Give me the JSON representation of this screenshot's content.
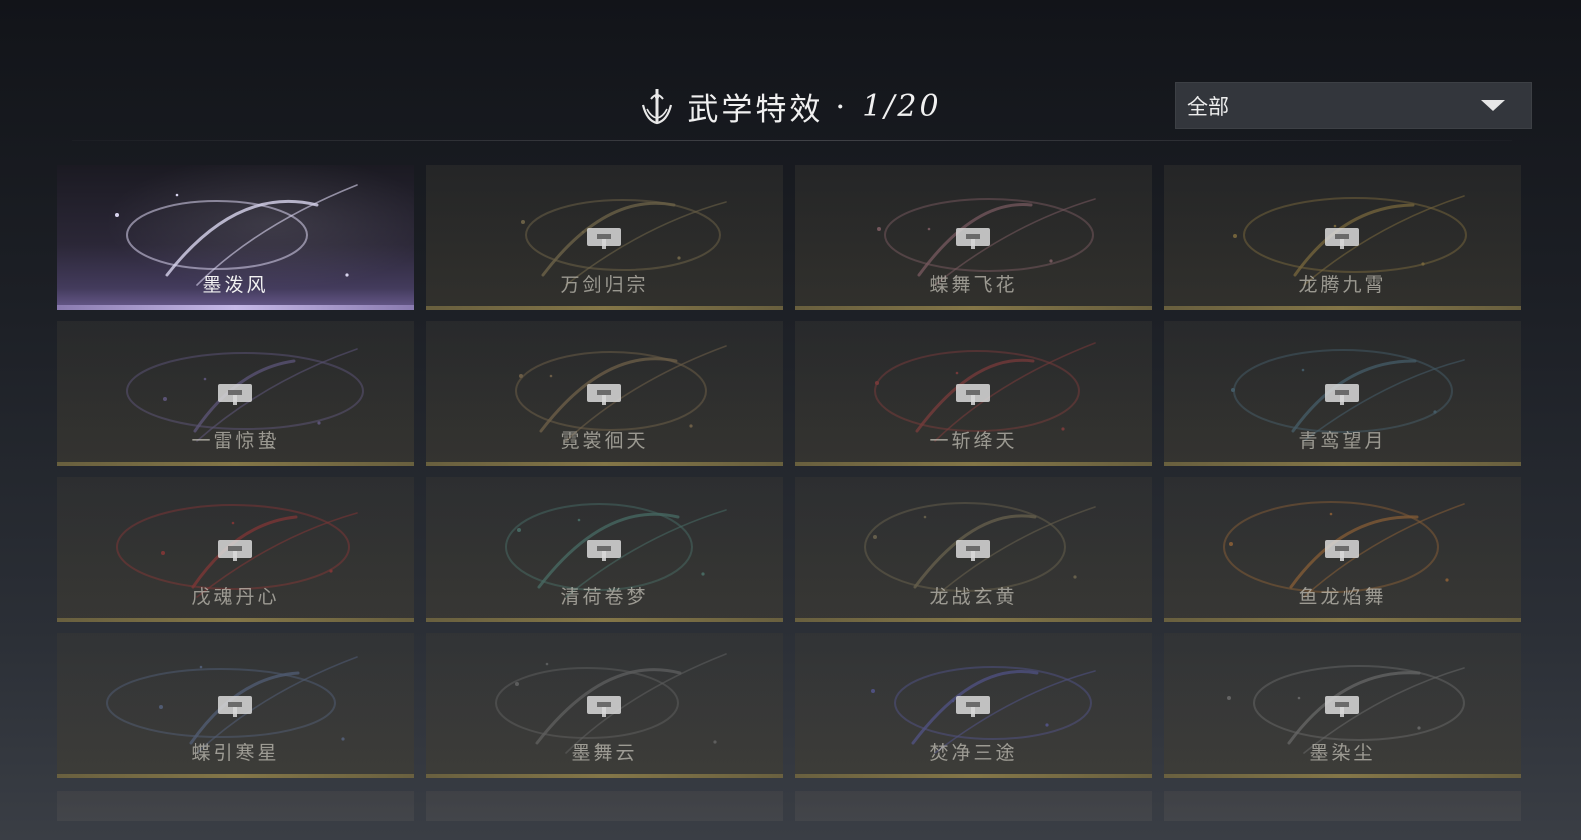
{
  "header": {
    "title": "武学特效",
    "separator": "·",
    "count": "1/20"
  },
  "filter": {
    "selected": "全部"
  },
  "effects": [
    {
      "name": "墨泼风",
      "unlocked": true,
      "theme": "#d8d4ee"
    },
    {
      "name": "万剑归宗",
      "unlocked": false,
      "theme": "#b9a36a"
    },
    {
      "name": "蝶舞飞花",
      "unlocked": false,
      "theme": "#c98a98"
    },
    {
      "name": "龙腾九霄",
      "unlocked": false,
      "theme": "#c9a650"
    },
    {
      "name": "一雷惊蛰",
      "unlocked": false,
      "theme": "#8f7ec9"
    },
    {
      "name": "霓裳徊天",
      "unlocked": false,
      "theme": "#b49565"
    },
    {
      "name": "一斩绛天",
      "unlocked": false,
      "theme": "#c94848"
    },
    {
      "name": "青鸾望月",
      "unlocked": false,
      "theme": "#5e8ea8"
    },
    {
      "name": "戊魂丹心",
      "unlocked": false,
      "theme": "#d43a3a"
    },
    {
      "name": "清荷卷梦",
      "unlocked": false,
      "theme": "#5fa79a"
    },
    {
      "name": "龙战玄黄",
      "unlocked": false,
      "theme": "#a3936a"
    },
    {
      "name": "鱼龙焰舞",
      "unlocked": false,
      "theme": "#e08a3a"
    },
    {
      "name": "蝶引寒星",
      "unlocked": false,
      "theme": "#6e86b8"
    },
    {
      "name": "墨舞云",
      "unlocked": false,
      "theme": "#8a8a8a"
    },
    {
      "name": "焚净三途",
      "unlocked": false,
      "theme": "#6d6fd8"
    },
    {
      "name": "墨染尘",
      "unlocked": false,
      "theme": "#9a9a9a"
    }
  ],
  "icons": {
    "emblem": "sword-emblem-icon",
    "lock": "lock-icon",
    "dropdown": "chevron-down-icon"
  }
}
